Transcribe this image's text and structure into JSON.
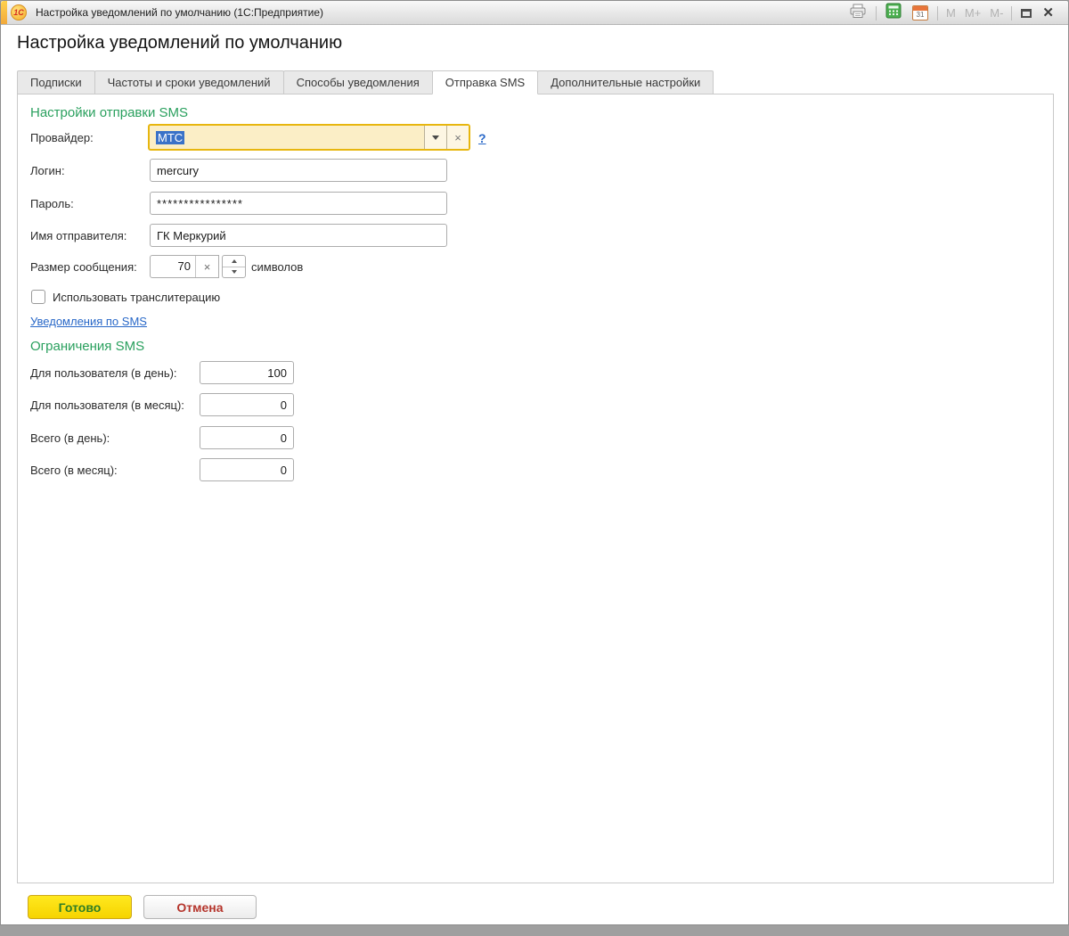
{
  "window": {
    "logo_text": "1С",
    "title": "Настройка уведомлений по умолчанию (1С:Предприятие)",
    "calendar_day": "31",
    "memory_buttons": {
      "m": "M",
      "m_plus": "M+",
      "m_minus": "M-"
    },
    "close_glyph": "✕"
  },
  "page": {
    "heading": "Настройка уведомлений по умолчанию"
  },
  "tabs": [
    {
      "label": "Подписки",
      "active": false
    },
    {
      "label": "Частоты и сроки уведомлений",
      "active": false
    },
    {
      "label": "Способы уведомления",
      "active": false
    },
    {
      "label": "Отправка SMS",
      "active": true
    },
    {
      "label": "Дополнительные настройки",
      "active": false
    }
  ],
  "sms_settings": {
    "section_title": "Настройки отправки SMS",
    "provider_label": "Провайдер:",
    "provider_value": "МТС",
    "help_label": "?",
    "clear_glyph": "×",
    "login_label": "Логин:",
    "login_value": "mercury",
    "password_label": "Пароль:",
    "password_value": "****************",
    "sender_label": "Имя отправителя:",
    "sender_value": "ГК Меркурий",
    "size_label": "Размер сообщения:",
    "size_value": "70",
    "size_suffix": "символов",
    "translit_label": "Использовать транслитерацию",
    "translit_checked": false,
    "sms_link": "Уведомления по SMS"
  },
  "sms_limits": {
    "section_title": "Ограничения SMS",
    "rows": [
      {
        "label": "Для пользователя (в день):",
        "value": "100"
      },
      {
        "label": "Для пользователя (в месяц):",
        "value": "0"
      },
      {
        "label": "Всего (в день):",
        "value": "0"
      },
      {
        "label": "Всего (в месяц):",
        "value": "0"
      }
    ]
  },
  "footer": {
    "done": "Готово",
    "cancel": "Отмена"
  },
  "colors": {
    "accent_green": "#2aa05e",
    "highlight_border": "#e7b60f",
    "highlight_bg": "#fbeec6",
    "selection_blue": "#3a72c8",
    "link_blue": "#2968c8",
    "done_yellow": "#f6d400",
    "done_text_green": "#2f7d25",
    "cancel_text_red": "#b5352c"
  }
}
